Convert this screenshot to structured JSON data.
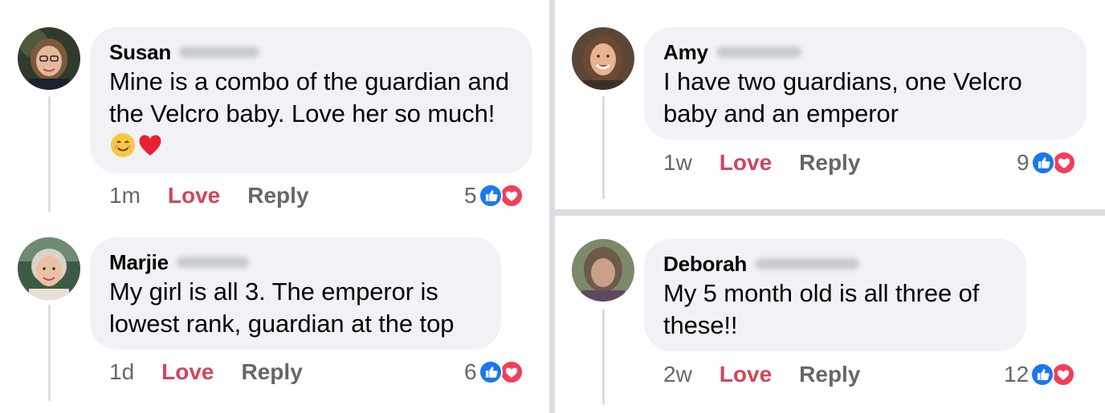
{
  "comments": [
    {
      "name": "Susan",
      "text": "Mine is a combo of the guardian and the Velcro baby. Love her so much!",
      "emojis": [
        "smiling-face-emoji",
        "red-heart-emoji"
      ],
      "time": "1m",
      "love_label": "Love",
      "reply_label": "Reply",
      "reaction_count": "5"
    },
    {
      "name": "Marjie",
      "text": "My girl is all 3. The emperor is lowest rank, guardian at the top",
      "time": "1d",
      "love_label": "Love",
      "reply_label": "Reply",
      "reaction_count": "6"
    },
    {
      "name": "Amy",
      "text": "I have two guardians, one Velcro baby and an emperor",
      "time": "1w",
      "love_label": "Love",
      "reply_label": "Reply",
      "reaction_count": "9"
    },
    {
      "name": "Deborah",
      "text": "My 5 month old is all three of these!!",
      "time": "2w",
      "love_label": "Love",
      "reply_label": "Reply",
      "reaction_count": "12"
    }
  ],
  "colors": {
    "love": "#d2455a",
    "like_icon": "#1877f2",
    "heart_icon": "#f33e58",
    "bubble": "#f0f2f5"
  },
  "icons": [
    "like-icon",
    "heart-icon"
  ]
}
